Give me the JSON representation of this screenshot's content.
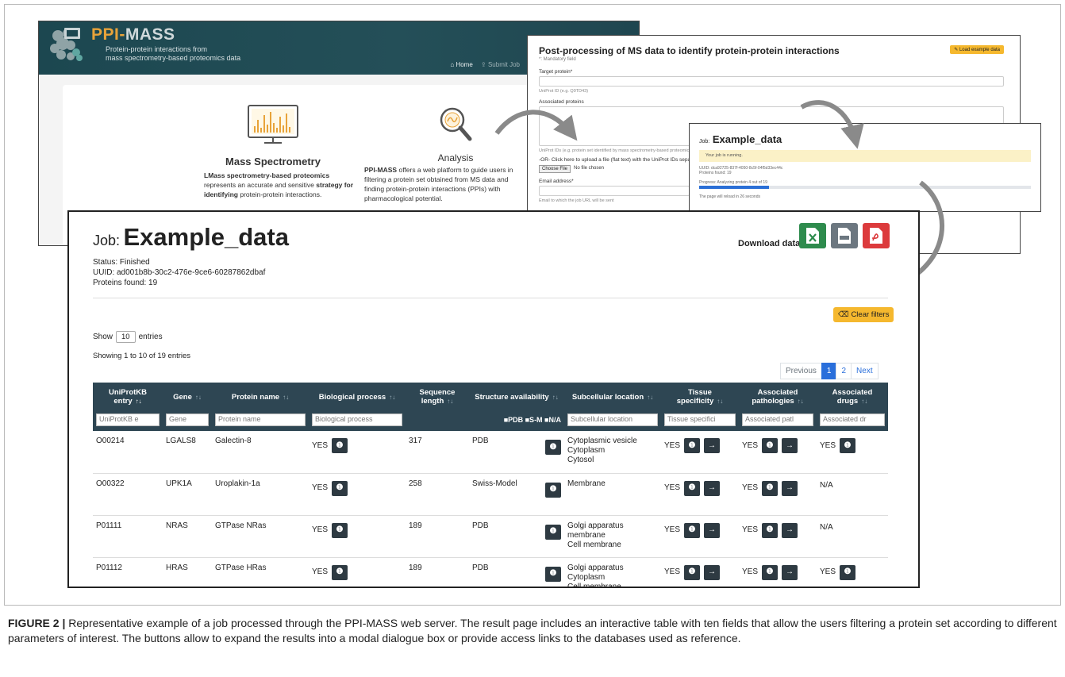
{
  "home": {
    "brand_ppi": "PPI-",
    "brand_mass": "MASS",
    "tagline_1": "Protein-protein interactions from",
    "tagline_2": "mass spectrometry-based proteomics data",
    "nav_home": "Home",
    "nav_submit": "Submit Job",
    "ms_title": "Mass Spectrometry",
    "ms_text_1": "LMass spectrometry-based proteomics",
    "ms_text_2": "represents an accurate and sensitive",
    "ms_text_3": "strategy for",
    "ms_text_4": "identifying",
    "ms_text_5": "protein-protein interactions.",
    "an_title": "Analysis",
    "an_brand": "PPI-MASS",
    "an_text_1": "offers a web platform to guide users in",
    "an_text_2": "filtering a protein set obtained from MS data and",
    "an_text_3": "finding protein-protein interactions (PPIs) with",
    "an_text_4": "pharmacological potential."
  },
  "form": {
    "title": "Post-processing of MS data to identify protein-protein interactions",
    "mandatory": "*: Mandatory field",
    "load_example": "Load example data",
    "target_label": "Target protein*",
    "target_hint": "UniProt ID (e.g. Q9TD43)",
    "assoc_label": "Associated proteins",
    "assoc_hint": "UniProt IDs (e.g. protein set identified by mass spectrometry-based proteomics)",
    "upload_label": "-OR- Click here to upload a file (flat text) with the UniProt IDs separated",
    "choose_file": "Choose File",
    "no_file": "No file chosen",
    "email_label": "Email address*",
    "email_hint": "Email to which the job URL will be sent"
  },
  "running": {
    "title_prefix": "Job:",
    "title_name": "Example_data",
    "alert": "Your job is running.",
    "uuid": "UUID: dca92725-837f-4050-8c5f-04f5d33ec44c",
    "proteins": "Proteins found: 19",
    "progress_text": "Progress: Analyzing protein 4 out of 19",
    "progress_fraction": 0.21,
    "reload": "The page will reload in 26 seconds"
  },
  "job": {
    "title_prefix": "Job:",
    "title_name": "Example_data",
    "status": "Status: Finished",
    "uuid": "UUID: ad001b8b-30c2-476e-9ce6-60287862dbaf",
    "proteins": "Proteins found: 19",
    "download_label": "Download data:",
    "download_icons": [
      "excel-icon",
      "csv-icon",
      "pdf-icon"
    ],
    "clear_filters": "Clear filters",
    "show_label": "Show",
    "show_value": "10",
    "entries_label": "entries",
    "showing": "Showing 1 to 10 of 19 entries",
    "pager": {
      "previous": "Previous",
      "page1": "1",
      "page2": "2",
      "next": "Next"
    }
  },
  "table": {
    "columns": [
      "UniProtKB entry",
      "Gene",
      "Protein name",
      "Biological process",
      "Sequence length",
      "Structure availability",
      "Subcellular location",
      "Tissue specificity",
      "Associated pathologies",
      "Associated drugs"
    ],
    "filters": [
      "UniProtKB e",
      "Gene",
      "Protein name",
      "Biological process",
      "",
      "",
      "Subcellular location",
      "Tissue specifici",
      "Associated patl",
      "Associated dr"
    ],
    "structure_legend": "■PDB ■S-M ■N/A",
    "rows": [
      {
        "entry": "O00214",
        "gene": "LGALS8",
        "protein": "Galectin-8",
        "bio": "YES",
        "length": "317",
        "structure": "PDB",
        "location": [
          "Cytoplasmic vesicle",
          "Cytoplasm",
          "Cytosol"
        ],
        "tissue": "YES",
        "pathologies": "YES",
        "drugs": "YES"
      },
      {
        "entry": "O00322",
        "gene": "UPK1A",
        "protein": "Uroplakin-1a",
        "bio": "YES",
        "length": "258",
        "structure": "Swiss-Model",
        "location": [
          "Membrane"
        ],
        "tissue": "YES",
        "pathologies": "YES",
        "drugs": "N/A"
      },
      {
        "entry": "P01111",
        "gene": "NRAS",
        "protein": "GTPase NRas",
        "bio": "YES",
        "length": "189",
        "structure": "PDB",
        "location": [
          "Golgi apparatus",
          "membrane",
          "Cell membrane"
        ],
        "tissue": "YES",
        "pathologies": "YES",
        "drugs": "N/A"
      },
      {
        "entry": "P01112",
        "gene": "HRAS",
        "protein": "GTPase HRas",
        "bio": "YES",
        "length": "189",
        "structure": "PDB",
        "location": [
          "Golgi apparatus",
          "Cytoplasm",
          "Cell membrane"
        ],
        "tissue": "YES",
        "pathologies": "YES",
        "drugs": "YES"
      }
    ]
  },
  "caption": {
    "label": "FIGURE 2 |",
    "text": "Representative example of a job processed through the PPI-MASS web server. The result page includes an interactive table with ten fields that allow the users filtering a protein set according to different parameters of interest. The buttons allow to expand the results into a modal dialogue box or provide access links to the databases used as reference."
  },
  "colors": {
    "header_dark": "#2e4653",
    "accent_orange": "#e8a33a",
    "clear_button": "#f5b82e",
    "excel_green": "#2e8b4d",
    "csv_gray": "#6c7780",
    "pdf_red": "#dc3a3c",
    "link_blue": "#2a6fdb"
  }
}
